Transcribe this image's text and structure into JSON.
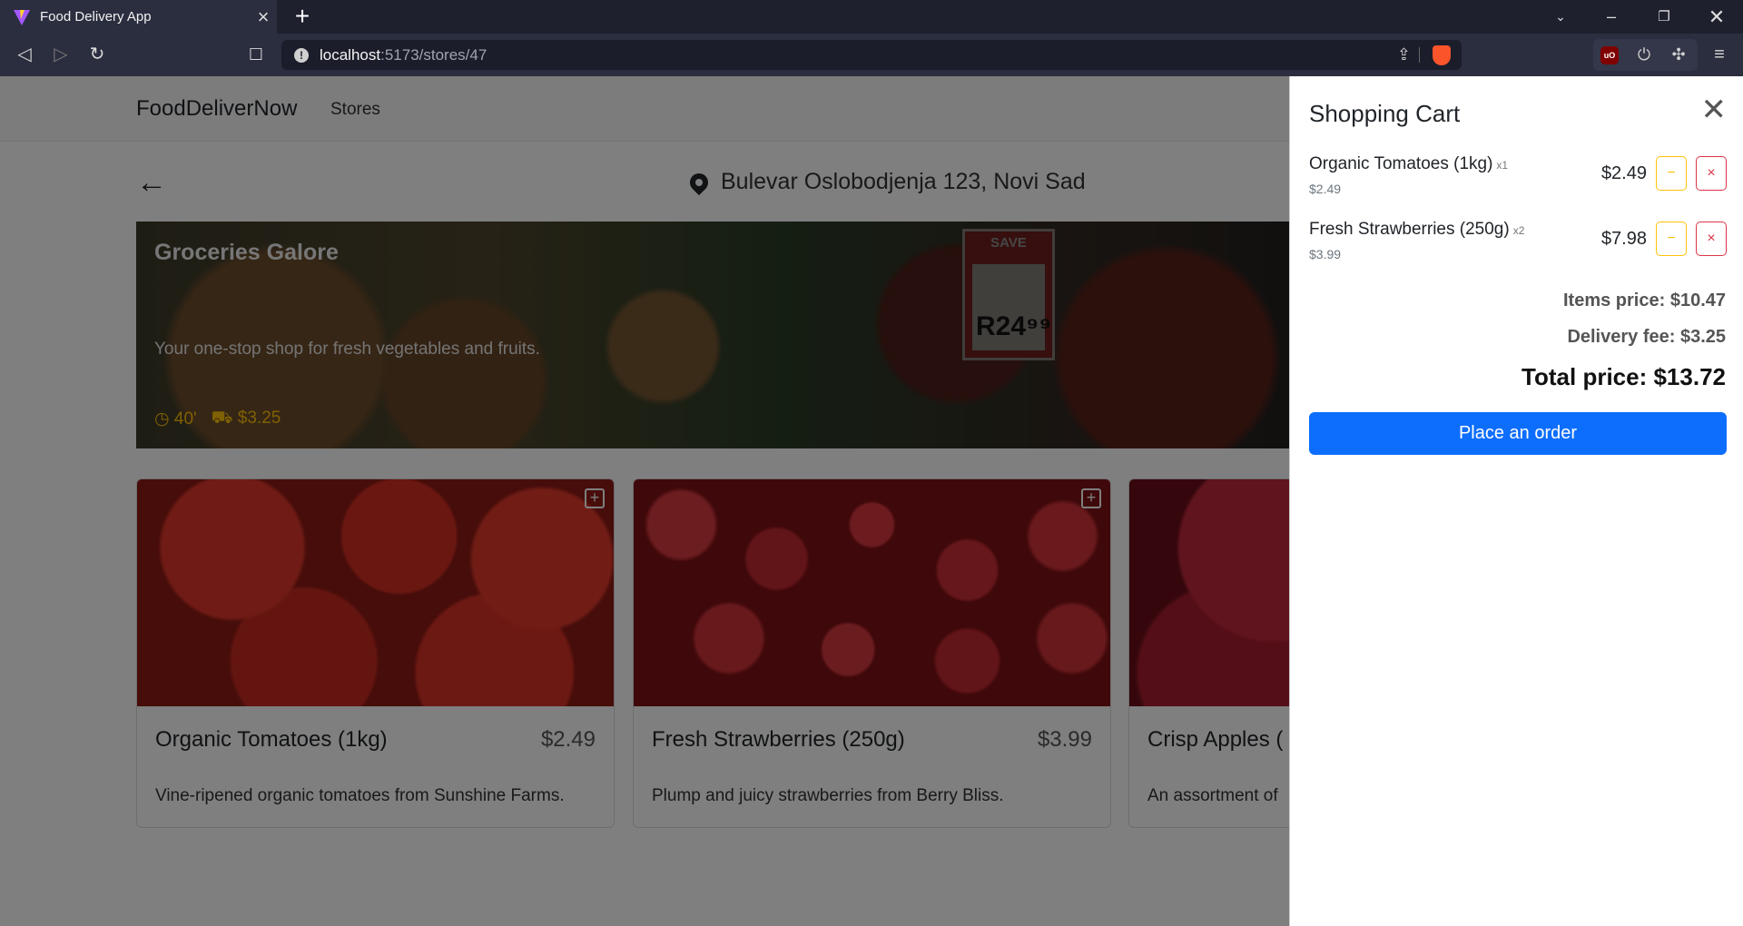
{
  "browser": {
    "tab_title": "Food Delivery App",
    "tab_close": "×",
    "new_tab": "+",
    "url_host": "localhost",
    "url_path": ":5173/stores/47",
    "ublock_label": "uO"
  },
  "navbar": {
    "brand": "FoodDeliverNow",
    "links": [
      "Stores"
    ]
  },
  "store": {
    "address": "Bulevar Oslobodjenja 123, Novi Sad",
    "name": "Groceries Galore",
    "description": "Your one-stop shop for fresh vegetables and fruits.",
    "delivery_time": "40'",
    "delivery_fee": "$3.25",
    "sign_text": "SAVE",
    "sign_price": "R24⁹⁹"
  },
  "products": [
    {
      "name": "Organic Tomatoes (1kg)",
      "price": "$2.49",
      "description": "Vine-ripened organic tomatoes from Sunshine Farms."
    },
    {
      "name": "Fresh Strawberries (250g)",
      "price": "$3.99",
      "description": "Plump and juicy strawberries from Berry Bliss."
    },
    {
      "name": "Crisp Apples (",
      "price": "",
      "description": "An assortment of"
    }
  ],
  "cart": {
    "title": "Shopping Cart",
    "items": [
      {
        "name": "Organic Tomatoes (1kg)",
        "qty": "x1",
        "unit_price": "$2.49",
        "total": "$2.49"
      },
      {
        "name": "Fresh Strawberries (250g)",
        "qty": "x2",
        "unit_price": "$3.99",
        "total": "$7.98"
      }
    ],
    "items_price": "Items price: $10.47",
    "delivery_fee": "Delivery fee: $3.25",
    "total_price": "Total price: $13.72",
    "order_button": "Place an order"
  },
  "colors": {
    "primary": "#0d6efd",
    "warning": "#ffc107",
    "danger": "#dc3545"
  }
}
